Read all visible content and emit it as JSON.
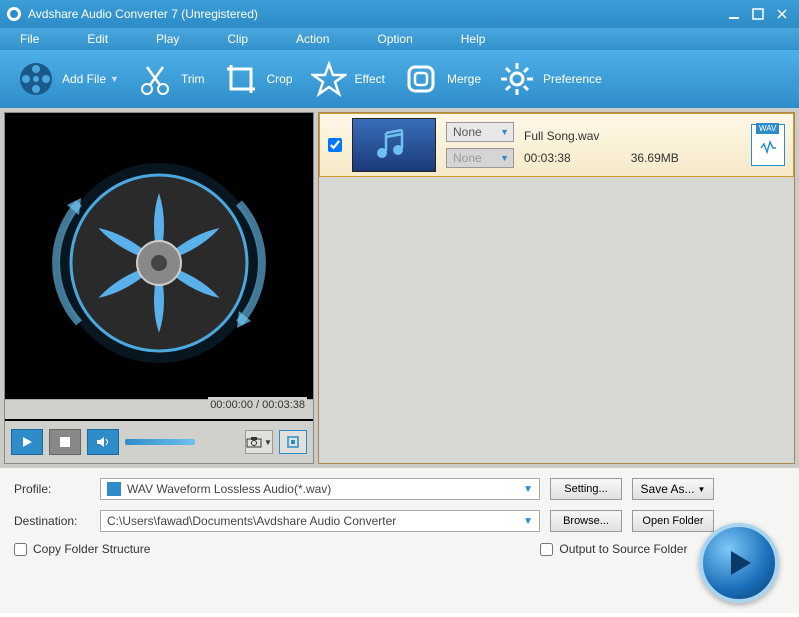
{
  "window": {
    "title": "Avdshare Audio Converter 7 (Unregistered)"
  },
  "menubar": {
    "file": "File",
    "edit": "Edit",
    "play": "Play",
    "clip": "Clip",
    "action": "Action",
    "option": "Option",
    "help": "Help"
  },
  "toolbar": {
    "add_file": "Add File",
    "trim": "Trim",
    "crop": "Crop",
    "effect": "Effect",
    "merge": "Merge",
    "preference": "Preference"
  },
  "preview": {
    "time": "00:00:00 / 00:03:38"
  },
  "items": [
    {
      "checked": true,
      "select1": "None",
      "select2": "None",
      "filename": "Full Song.wav",
      "duration": "00:03:38",
      "size": "36.69MB",
      "ext": "WAV"
    }
  ],
  "bottom": {
    "profile_label": "Profile:",
    "profile_value": "WAV Waveform Lossless Audio(*.wav)",
    "setting": "Setting...",
    "save_as": "Save As...",
    "destination_label": "Destination:",
    "destination_value": "C:\\Users\\fawad\\Documents\\Avdshare Audio Converter",
    "browse": "Browse...",
    "open_folder": "Open Folder",
    "copy_folder": "Copy Folder Structure",
    "output_source": "Output to Source Folder"
  }
}
